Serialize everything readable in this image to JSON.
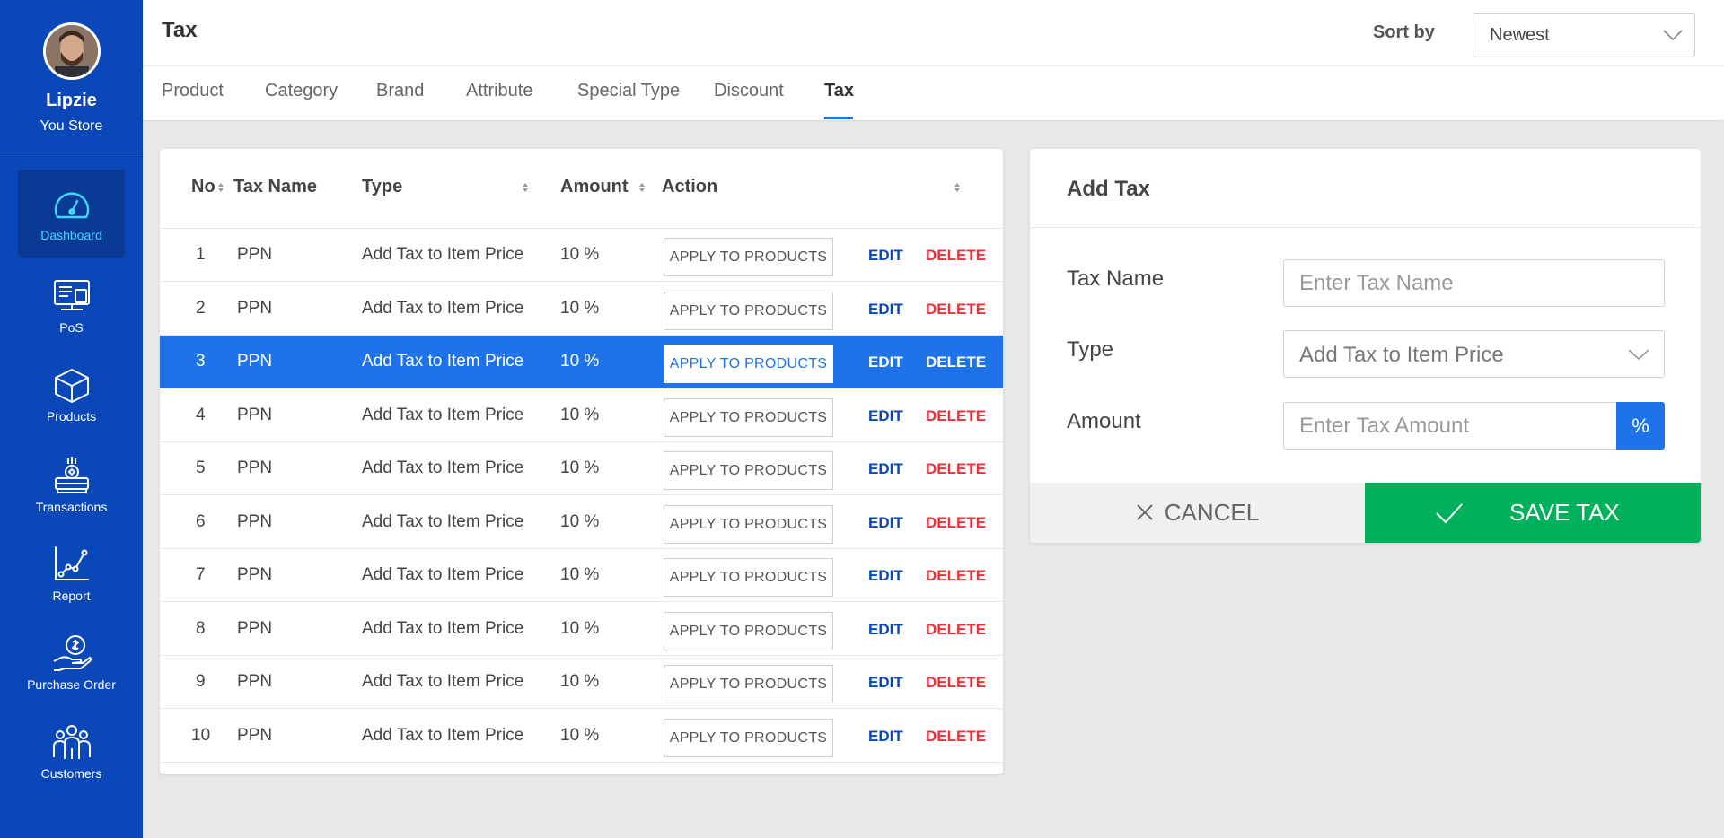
{
  "sidebar": {
    "store_name": "Lipzie",
    "store_sub": "You Store",
    "items": [
      {
        "label": "Dashboard",
        "icon": "gauge-icon",
        "active": true
      },
      {
        "label": "PoS",
        "icon": "pos-terminal-icon",
        "active": false
      },
      {
        "label": "Products",
        "icon": "box-icon",
        "active": false
      },
      {
        "label": "Transactions",
        "icon": "cash-register-icon",
        "active": false
      },
      {
        "label": "Report",
        "icon": "line-chart-icon",
        "active": false
      },
      {
        "label": "Purchase Order",
        "icon": "hand-coin-icon",
        "active": false
      },
      {
        "label": "Customers",
        "icon": "people-group-icon",
        "active": false
      }
    ]
  },
  "header": {
    "title": "Tax",
    "sort_label": "Sort by",
    "sort_value": "Newest"
  },
  "tabs": [
    {
      "label": "Product",
      "active": false
    },
    {
      "label": "Category",
      "active": false
    },
    {
      "label": "Brand",
      "active": false
    },
    {
      "label": "Attribute",
      "active": false
    },
    {
      "label": "Special Type",
      "active": false
    },
    {
      "label": "Discount",
      "active": false
    },
    {
      "label": "Tax",
      "active": true
    }
  ],
  "table": {
    "columns": [
      "No",
      "Tax Name",
      "Type",
      "Amount",
      "Action"
    ],
    "apply_label": "APPLY TO PRODUCTS",
    "edit_label": "EDIT",
    "delete_label": "DELETE",
    "selected_row": 3,
    "rows": [
      {
        "no": "1",
        "name": "PPN",
        "type": "Add Tax to Item Price",
        "amount": "10 %"
      },
      {
        "no": "2",
        "name": "PPN",
        "type": "Add Tax to Item Price",
        "amount": "10 %"
      },
      {
        "no": "3",
        "name": "PPN",
        "type": "Add Tax to Item Price",
        "amount": "10 %"
      },
      {
        "no": "4",
        "name": "PPN",
        "type": "Add Tax to Item Price",
        "amount": "10 %"
      },
      {
        "no": "5",
        "name": "PPN",
        "type": "Add Tax to Item Price",
        "amount": "10 %"
      },
      {
        "no": "6",
        "name": "PPN",
        "type": "Add Tax to Item Price",
        "amount": "10 %"
      },
      {
        "no": "7",
        "name": "PPN",
        "type": "Add Tax to Item Price",
        "amount": "10 %"
      },
      {
        "no": "8",
        "name": "PPN",
        "type": "Add Tax to Item Price",
        "amount": "10 %"
      },
      {
        "no": "9",
        "name": "PPN",
        "type": "Add Tax to Item Price",
        "amount": "10 %"
      },
      {
        "no": "10",
        "name": "PPN",
        "type": "Add Tax to Item Price",
        "amount": "10 %"
      }
    ]
  },
  "add_tax": {
    "title": "Add Tax",
    "name_label": "Tax Name",
    "name_placeholder": "Enter Tax Name",
    "type_label": "Type",
    "type_value": "Add Tax to Item Price",
    "amount_label": "Amount",
    "amount_placeholder": "Enter Tax Amount",
    "amount_unit": "%",
    "cancel_label": "CANCEL",
    "save_label": "SAVE TAX"
  },
  "colors": {
    "sidebar": "#0a47b8",
    "accent": "#1e73e8",
    "save": "#00b05a",
    "delete": "#e8323c"
  }
}
